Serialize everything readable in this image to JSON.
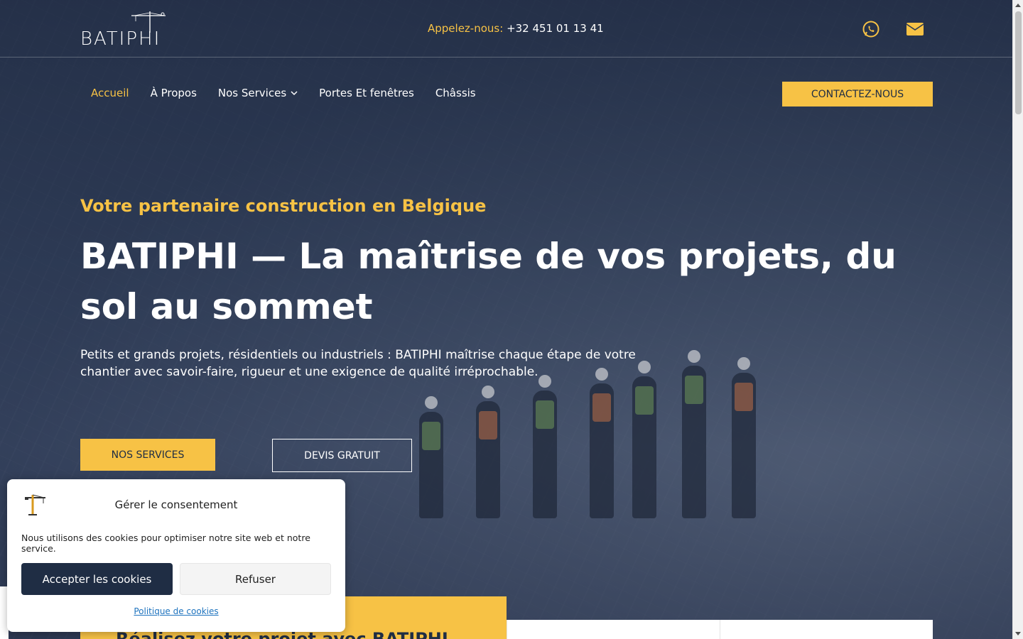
{
  "brand": {
    "logo_text": "BATIPHI",
    "accent": "#f7c245",
    "dark": "#1f2d44"
  },
  "topbar": {
    "phone_label": "Appelez-nous:",
    "phone_number": "+32 451 01 13 41"
  },
  "nav": {
    "items": [
      {
        "label": "Accueil"
      },
      {
        "label": "À Propos"
      },
      {
        "label": "Nos Services"
      },
      {
        "label": "Portes Et fenêtres"
      },
      {
        "label": "Châssis"
      }
    ],
    "cta": "CONTACTEZ-NOUS"
  },
  "hero": {
    "eyebrow": "Votre partenaire construction en Belgique",
    "title": "BATIPHI — La maîtrise de vos projets, du sol au sommet",
    "lead": "Petits et grands projets, résidentiels ou industriels : BATIPHI maîtrise chaque étape de votre chantier avec savoir-faire, rigueur et une exigence de qualité irréprochable.",
    "btn_primary": "NOS SERVICES",
    "btn_secondary": "DEVIS GRATUIT"
  },
  "bottom": {
    "title": "Réalisez votre projet avec BATIPHI"
  },
  "cookie": {
    "title": "Gérer le consentement",
    "text": "Nous utilisons des cookies pour optimiser notre site web et notre service.",
    "accept": "Accepter les cookies",
    "refuse": "Refuser",
    "policy": "Politique de cookies"
  },
  "icons": {
    "whatsapp": "whatsapp-icon",
    "mail": "mail-icon",
    "chevron": "chevron-down-icon",
    "crane": "crane-icon"
  }
}
